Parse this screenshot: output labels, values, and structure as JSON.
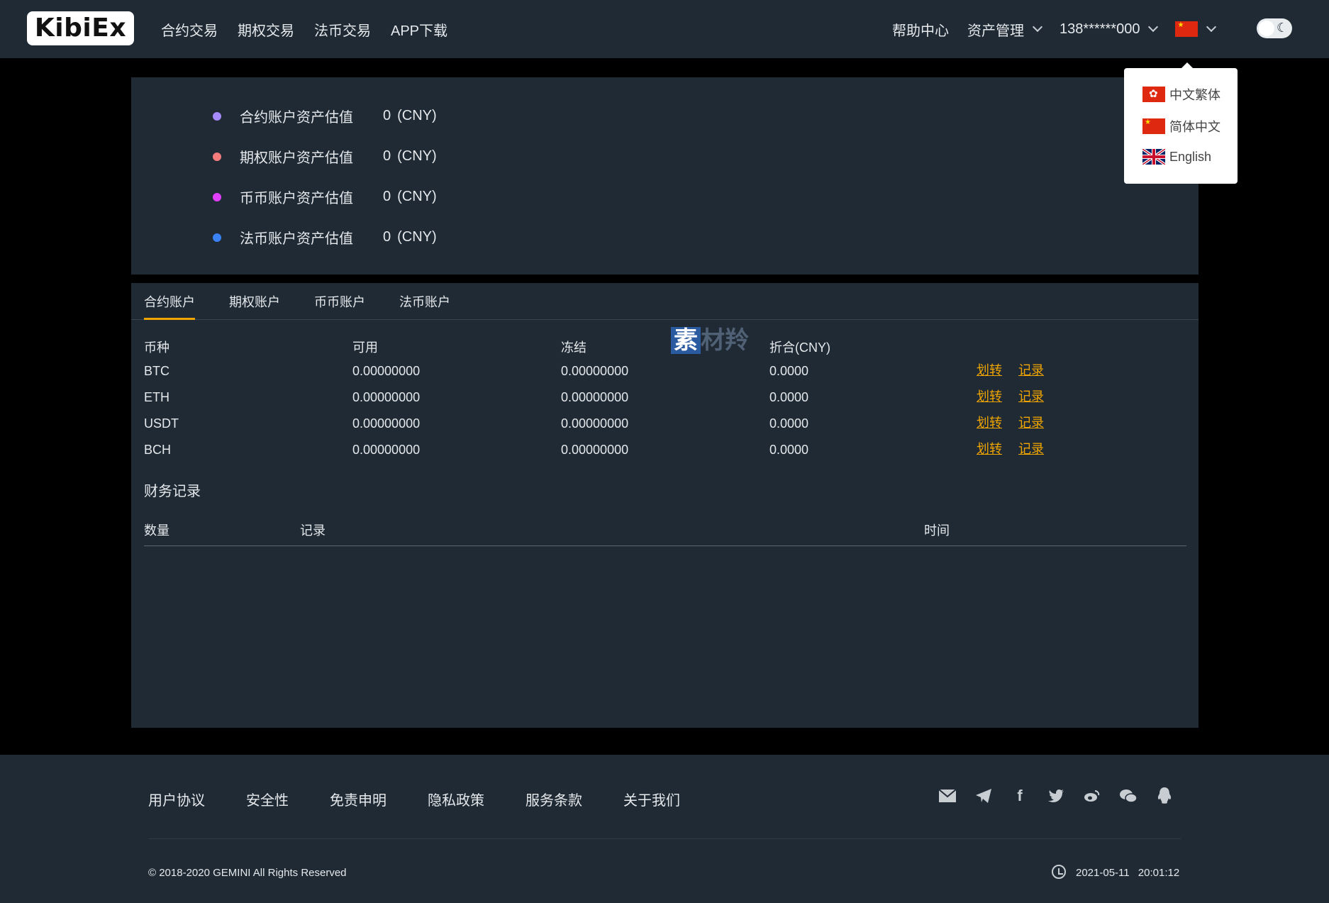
{
  "header": {
    "logo": "KibiEx",
    "nav_left": [
      "合约交易",
      "期权交易",
      "法币交易",
      "APP下载"
    ],
    "help": "帮助中心",
    "assets": "资产管理",
    "user": "138******000"
  },
  "lang_menu": {
    "items": [
      {
        "label": "中文繁体",
        "flag": "hk-flag-icon"
      },
      {
        "label": "简体中文",
        "flag": "cn-flag-icon"
      },
      {
        "label": "English",
        "flag": "uk-flag-icon"
      }
    ]
  },
  "summary": {
    "rows": [
      {
        "label": "合约账户资产估值",
        "value": "0",
        "unit": "(CNY)",
        "color": "#a78bfa"
      },
      {
        "label": "期权账户资产估值",
        "value": "0",
        "unit": "(CNY)",
        "color": "#f47c7c"
      },
      {
        "label": "币币账户资产估值",
        "value": "0",
        "unit": "(CNY)",
        "color": "#e040fb"
      },
      {
        "label": "法币账户资产估值",
        "value": "0",
        "unit": "(CNY)",
        "color": "#3b82f6"
      }
    ]
  },
  "accounts": {
    "tabs": [
      "合约账户",
      "期权账户",
      "币币账户",
      "法币账户"
    ],
    "columns": [
      "币种",
      "可用",
      "冻结",
      "折合(CNY)"
    ],
    "rows": [
      {
        "coin": "BTC",
        "available": "0.00000000",
        "frozen": "0.00000000",
        "cny": "0.0000",
        "transfer": "划转",
        "record": "记录"
      },
      {
        "coin": "ETH",
        "available": "0.00000000",
        "frozen": "0.00000000",
        "cny": "0.0000",
        "transfer": "划转",
        "record": "记录"
      },
      {
        "coin": "USDT",
        "available": "0.00000000",
        "frozen": "0.00000000",
        "cny": "0.0000",
        "transfer": "划转",
        "record": "记录"
      },
      {
        "coin": "BCH",
        "available": "0.00000000",
        "frozen": "0.00000000",
        "cny": "0.0000",
        "transfer": "划转",
        "record": "记录"
      }
    ],
    "finance_title": "财务记录",
    "finance_columns": [
      "数量",
      "记录",
      "时间"
    ]
  },
  "watermark": {
    "badge": "素",
    "text": "材羚"
  },
  "footer": {
    "links": [
      "用户协议",
      "安全性",
      "免责申明",
      "隐私政策",
      "服务条款",
      "关于我们"
    ],
    "copyright": "© 2018-2020 GEMINI All Rights Reserved",
    "date": "2021-05-11",
    "time": "20:01:12"
  }
}
